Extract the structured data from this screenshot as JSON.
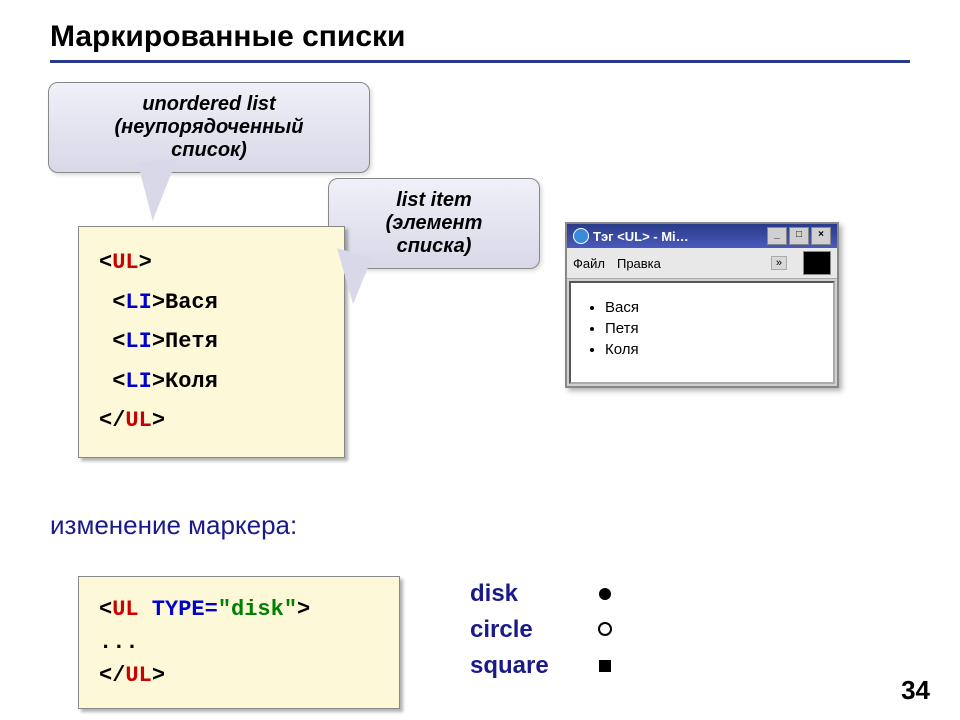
{
  "title": "Маркированные списки",
  "callout1": {
    "line1": "unordered list",
    "line2": "(неупорядоченный",
    "line3": "список)"
  },
  "callout2": {
    "line1": "list item",
    "line2": "(элемент",
    "line3": "списка)"
  },
  "code1": {
    "open_bracket": "<",
    "close_bracket": ">",
    "slash": "/",
    "ul": "UL",
    "li": "LI",
    "item1": "Вася",
    "item2": "Петя",
    "item3": "Коля"
  },
  "browser": {
    "title": "Тэг <UL> - Mi…",
    "menu_file": "Файл",
    "menu_edit": "Правка",
    "chevron": "»",
    "items": [
      "Вася",
      "Петя",
      "Коля"
    ]
  },
  "subheading": "изменение маркера:",
  "code2": {
    "line1_open": "<",
    "line1_ul": "UL",
    "line1_attr": " TYPE=",
    "line1_val": "\"disk\"",
    "line1_close": ">",
    "line2": "...",
    "line3_open": "<",
    "line3_slash": "/",
    "line3_ul": "UL",
    "line3_close": ">"
  },
  "markers": {
    "disk": "disk",
    "circle": "circle",
    "square": "square"
  },
  "page_number": "34"
}
